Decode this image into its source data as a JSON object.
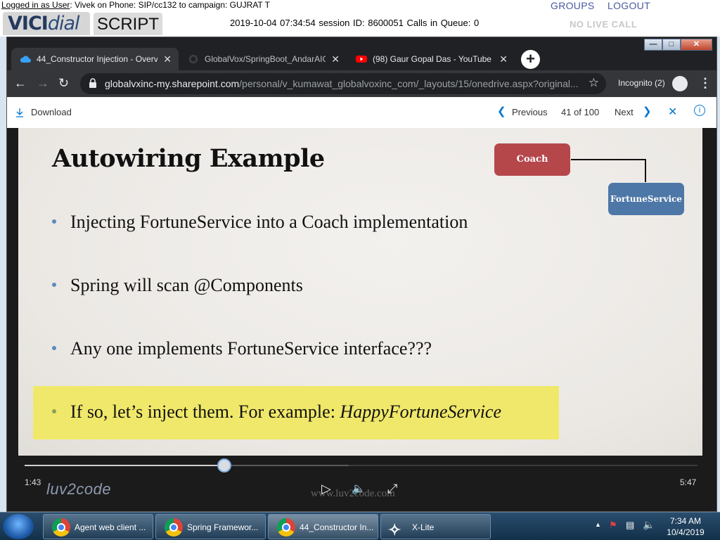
{
  "vicidial": {
    "status_prefix": "Logged in as User",
    "status_rest": ": Vivek on Phone: SIP/cc132  to campaign: GUJRAT  T",
    "logo_bold": "VICI",
    "logo_italic": "dial",
    "script_tab": "SCRIPT",
    "datetime": "2019-10-04 07:34:54   session ID: 8600051   Calls in Queue: 0",
    "groups": "GROUPS",
    "logout": "LOGOUT",
    "no_live_call": "NO LIVE CALL"
  },
  "browser": {
    "tabs": [
      {
        "label": "44_Constructor Injection - Overvi",
        "icon": "onedrive-cloud-icon",
        "active": true
      },
      {
        "label": "GlobalVox/SpringBoot_AndarAIG",
        "icon": "github-icon",
        "active": false
      },
      {
        "label": "(98) Gaur Gopal Das - YouTube",
        "icon": "youtube-icon",
        "active": false
      }
    ],
    "url_host": "globalvxinc-my.sharepoint.com",
    "url_path": "/personal/v_kumawat_globalvoxinc_com/_layouts/15/onedrive.aspx?original...",
    "incognito": "Incognito (2)"
  },
  "viewer": {
    "download": "Download",
    "previous": "Previous",
    "position": "41 of 100",
    "next": "Next"
  },
  "slide": {
    "title": "Autowiring Example",
    "coach": "Coach",
    "fortune_service": "FortuneService",
    "bullets": [
      "Injecting FortuneService into a Coach implementation",
      "Spring will scan @Components",
      "Any one implements FortuneService interface???"
    ],
    "highlight_prefix": "If so, let’s inject them. For example: ",
    "highlight_italic": "HappyFortuneService"
  },
  "player": {
    "current_time": "1:43",
    "duration": "5:47",
    "brand": "luv2code",
    "watermark": "www.luv2code.com",
    "progress_fraction": 0.297
  },
  "taskbar": {
    "items": [
      "Agent web client ...",
      "Spring Framewor...",
      "44_Constructor In...",
      "X-Lite"
    ],
    "time": "7:34 AM",
    "date": "10/4/2019"
  },
  "colors": {
    "coach_box": "#b5474b",
    "fortune_box": "#4d77a7",
    "highlight": "#f0e86a",
    "accent": "#0078d4"
  }
}
